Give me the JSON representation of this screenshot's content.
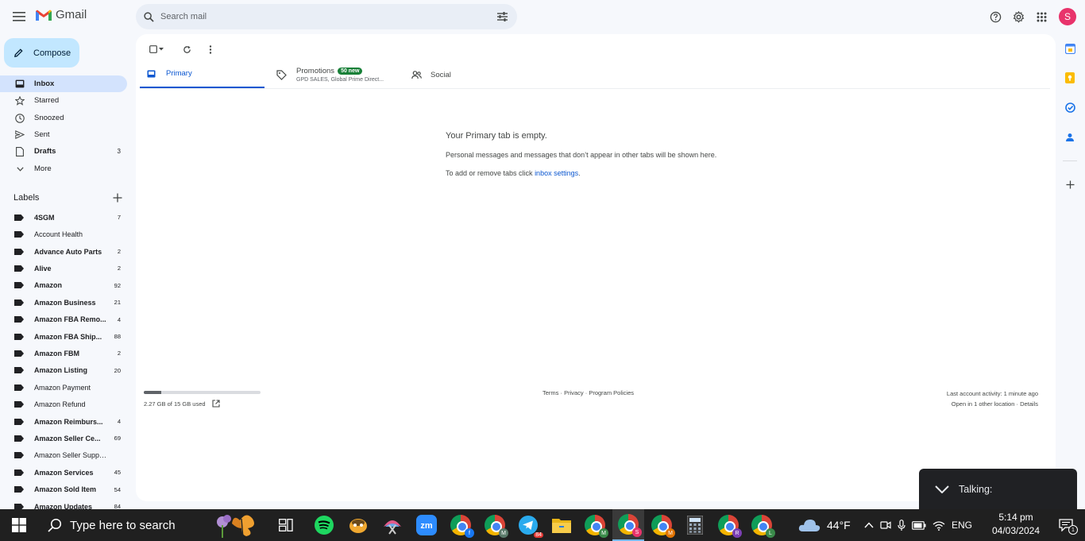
{
  "header": {
    "app_name": "Gmail",
    "search_placeholder": "Search mail",
    "avatar_letter": "S"
  },
  "compose_label": "Compose",
  "nav": [
    {
      "label": "Inbox",
      "count": "",
      "icon": "inbox-icon",
      "active": true
    },
    {
      "label": "Starred",
      "count": "",
      "icon": "star-icon"
    },
    {
      "label": "Snoozed",
      "count": "",
      "icon": "clock-icon"
    },
    {
      "label": "Sent",
      "count": "",
      "icon": "send-icon"
    },
    {
      "label": "Drafts",
      "count": "3",
      "icon": "draft-icon",
      "bold": true
    },
    {
      "label": "More",
      "count": "",
      "icon": "chevron-down-icon"
    }
  ],
  "labels_title": "Labels",
  "labels": [
    {
      "label": "4SGM",
      "count": "7",
      "bold": true
    },
    {
      "label": "Account Health",
      "count": ""
    },
    {
      "label": "Advance Auto Parts",
      "count": "2",
      "bold": true
    },
    {
      "label": "Alive",
      "count": "2",
      "bold": true
    },
    {
      "label": "Amazon",
      "count": "92",
      "bold": true
    },
    {
      "label": "Amazon Business",
      "count": "21",
      "bold": true
    },
    {
      "label": "Amazon FBA Remo...",
      "count": "4",
      "bold": true
    },
    {
      "label": "Amazon FBA Ship...",
      "count": "88",
      "bold": true
    },
    {
      "label": "Amazon FBM",
      "count": "2",
      "bold": true
    },
    {
      "label": "Amazon Listing",
      "count": "20",
      "bold": true
    },
    {
      "label": "Amazon Payment",
      "count": ""
    },
    {
      "label": "Amazon Refund",
      "count": ""
    },
    {
      "label": "Amazon Reimburs...",
      "count": "4",
      "bold": true
    },
    {
      "label": "Amazon Seller Ce...",
      "count": "69",
      "bold": true
    },
    {
      "label": "Amazon Seller Support",
      "count": ""
    },
    {
      "label": "Amazon Services",
      "count": "45",
      "bold": true
    },
    {
      "label": "Amazon Sold Item",
      "count": "54",
      "bold": true
    },
    {
      "label": "Amazon Updates",
      "count": "84",
      "bold": true
    }
  ],
  "tabs": {
    "primary": "Primary",
    "promotions": "Promotions",
    "promotions_badge": "50 new",
    "promotions_sub": "GPD SALES, Global Prime Direct...",
    "social": "Social"
  },
  "empty": {
    "title": "Your Primary tab is empty.",
    "desc": "Personal messages and messages that don’t appear in other tabs will be shown here.",
    "hint_prefix": "To add or remove tabs click ",
    "hint_link": "inbox settings",
    "hint_suffix": "."
  },
  "footer": {
    "storage_text": "2.27 GB of 15 GB used",
    "storage_fraction": 0.151,
    "links": "Terms · Privacy · Program Policies",
    "activity": "Last account activity: 1 minute ago",
    "open_locations": "Open in 1 other location · Details"
  },
  "talking_label": "Talking:",
  "taskbar": {
    "search_placeholder": "Type here to search",
    "weather": "44°F",
    "language": "ENG",
    "time": "5:14 pm",
    "date": "04/03/2024",
    "telegram_badge": "84",
    "notification_count": "1"
  },
  "colors": {
    "accent": "#0b57d0",
    "compose_bg": "#c2e7ff",
    "promo_badge": "#188038",
    "avatar": "#e8336b"
  }
}
